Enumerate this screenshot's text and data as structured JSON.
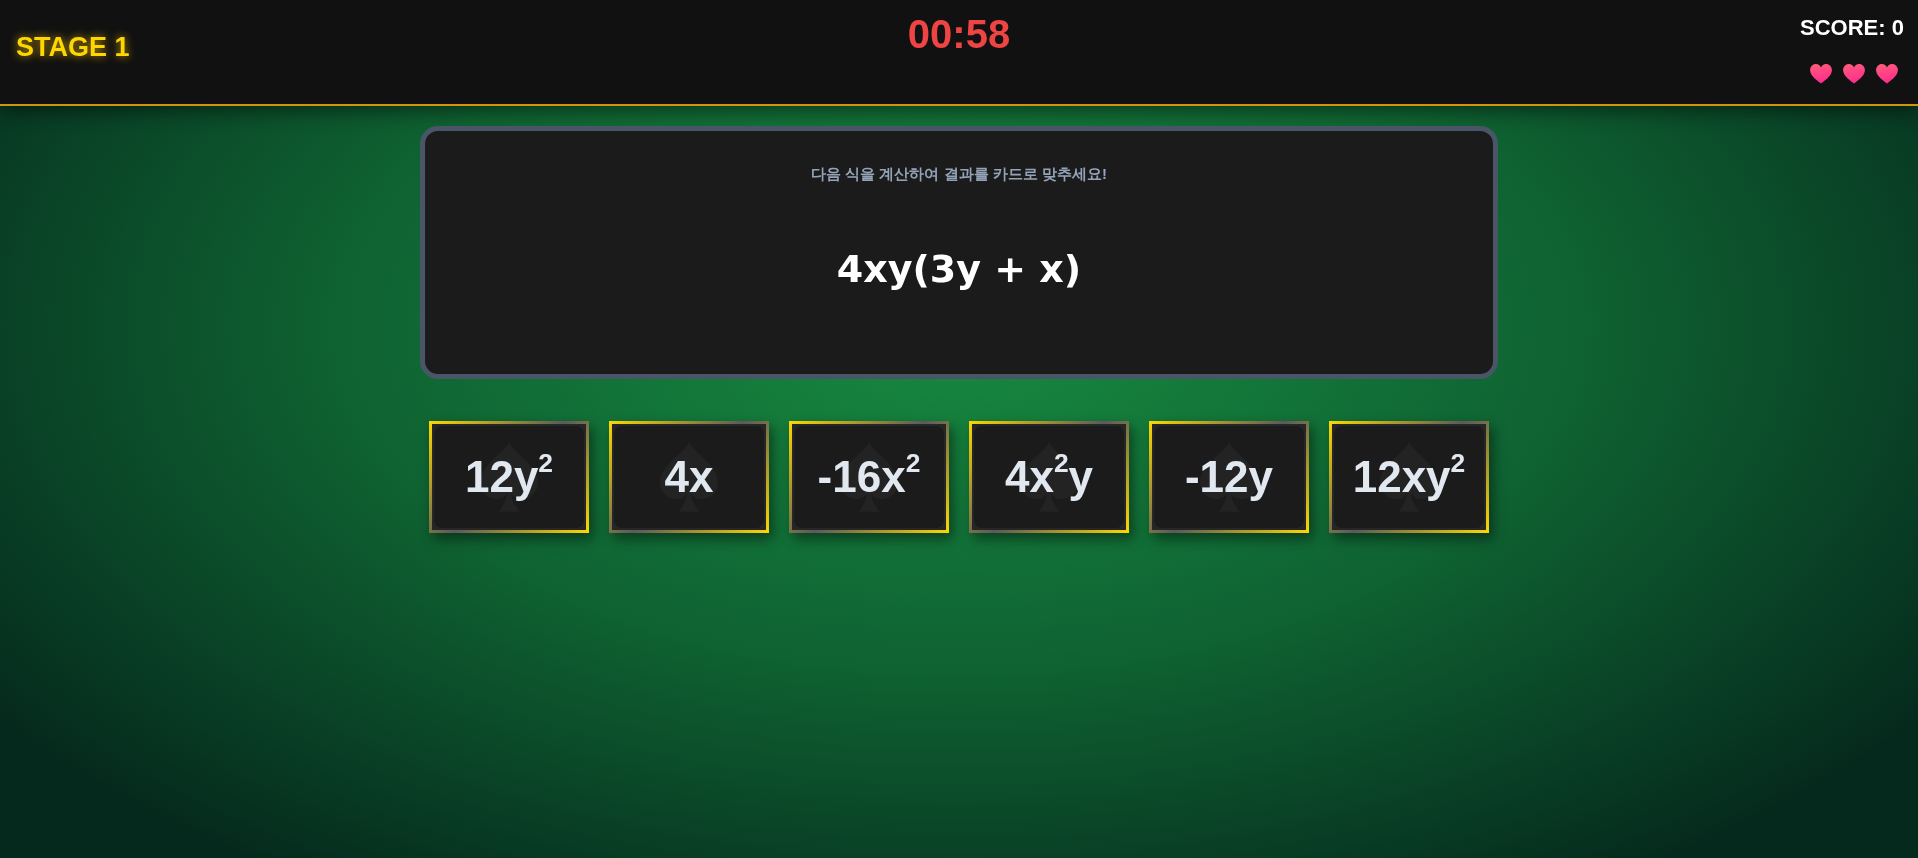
{
  "header": {
    "stage": "STAGE 1",
    "timer": "00:58",
    "score": "SCORE: 0",
    "lives": [
      {
        "filled": true
      },
      {
        "filled": true
      },
      {
        "filled": true
      }
    ]
  },
  "question": {
    "instruction": "다음 식을 계산하여 결과를 카드로 맞추세요!",
    "expression": "4xy(3y + x)"
  },
  "cards": [
    {
      "label": "12y$^{2}$"
    },
    {
      "label": "4x"
    },
    {
      "label": "-16x$^{2}$"
    },
    {
      "label": "4x$^{2}$y"
    },
    {
      "label": "-12y"
    },
    {
      "label": "12xy$^{2}$"
    }
  ]
}
